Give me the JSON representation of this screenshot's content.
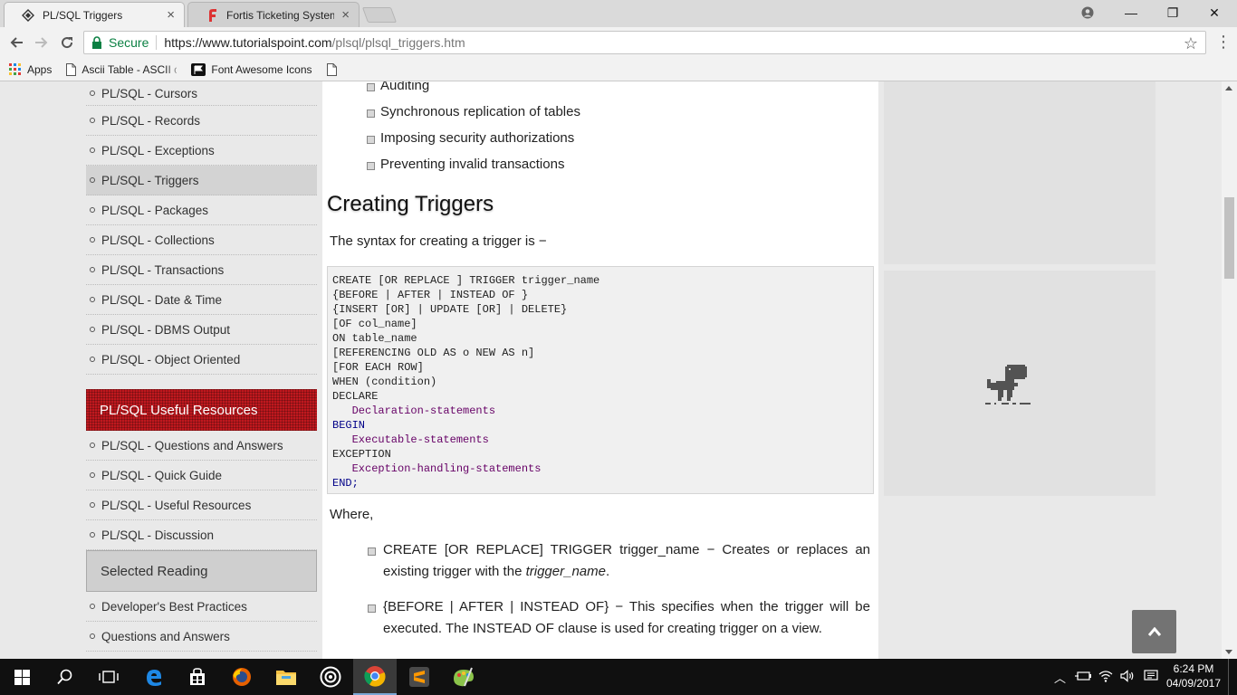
{
  "browser": {
    "tabs": [
      {
        "title": "PL/SQL Triggers",
        "close": "×",
        "active": true
      },
      {
        "title": "Fortis Ticketing System",
        "close": "×",
        "active": false
      }
    ],
    "window_controls": {
      "minimize": "—",
      "maximize": "❐",
      "close": "✕"
    },
    "omnibox": {
      "secure_label": "Secure",
      "url_host": "https://www.tutorialspoint.com",
      "url_path": "/plsql/plsql_triggers.htm"
    },
    "bookmarks": [
      {
        "label": "Apps",
        "icon": "apps-grid-icon"
      },
      {
        "label": "Ascii Table - ASCII ch",
        "icon": "page-icon"
      },
      {
        "label": "Font Awesome Icons",
        "icon": "flag-icon"
      },
      {
        "label": "",
        "icon": "page-icon"
      }
    ]
  },
  "sidebar": {
    "items_top": [
      {
        "label": "PL/SQL - Cursors"
      },
      {
        "label": "PL/SQL - Records"
      },
      {
        "label": "PL/SQL - Exceptions"
      },
      {
        "label": "PL/SQL - Triggers",
        "active": true
      },
      {
        "label": "PL/SQL - Packages"
      },
      {
        "label": "PL/SQL - Collections"
      },
      {
        "label": "PL/SQL - Transactions"
      },
      {
        "label": "PL/SQL - Date & Time"
      },
      {
        "label": "PL/SQL - DBMS Output"
      },
      {
        "label": "PL/SQL - Object Oriented"
      }
    ],
    "resources_heading": "PL/SQL Useful Resources",
    "resources": [
      {
        "label": "PL/SQL - Questions and Answers"
      },
      {
        "label": "PL/SQL - Quick Guide"
      },
      {
        "label": "PL/SQL - Useful Resources"
      },
      {
        "label": "PL/SQL - Discussion"
      }
    ],
    "reading_heading": "Selected Reading",
    "reading": [
      {
        "label": "Developer's Best Practices"
      },
      {
        "label": "Questions and Answers"
      }
    ]
  },
  "content": {
    "bullets": [
      "Auditing",
      "Synchronous replication of tables",
      "Imposing security authorizations",
      "Preventing invalid transactions"
    ],
    "heading": "Creating Triggers",
    "syntax_intro": "The syntax for creating a trigger is −",
    "code_lines": [
      "CREATE [OR REPLACE ] TRIGGER trigger_name",
      "{BEFORE | AFTER | INSTEAD OF }",
      "{INSERT [OR] | UPDATE [OR] | DELETE}",
      "[OF col_name]",
      "ON table_name",
      "[REFERENCING OLD AS o NEW AS n]",
      "[FOR EACH ROW]",
      "WHEN (condition)",
      "DECLARE",
      "   Declaration-statements",
      "BEGIN",
      "   Executable-statements",
      "EXCEPTION",
      "   Exception-handling-statements",
      "END;"
    ],
    "where_label": "Where,",
    "desc1_text": "CREATE [OR REPLACE] TRIGGER trigger_name − Creates or replaces an existing trigger with the ",
    "desc1_em": "trigger_name",
    "desc1_end": ".",
    "desc2_text": "{BEFORE | AFTER | INSTEAD OF} − This specifies when the trigger will be executed. The INSTEAD OF clause is used for creating trigger on a view."
  },
  "taskbar": {
    "clock_time": "6:24 PM",
    "clock_date": "04/09/2017",
    "apps": [
      "start-icon",
      "search-icon",
      "task-view-icon",
      "edge-icon",
      "store-icon",
      "firefox-icon",
      "file-explorer-icon",
      "obs-icon",
      "chrome-icon",
      "sublime-icon",
      "paint-icon"
    ]
  },
  "colors": {
    "accent_red": "#c0181e",
    "code_keyword": "#000088",
    "code_identifier": "#660066",
    "secure_green": "#0b8043"
  }
}
